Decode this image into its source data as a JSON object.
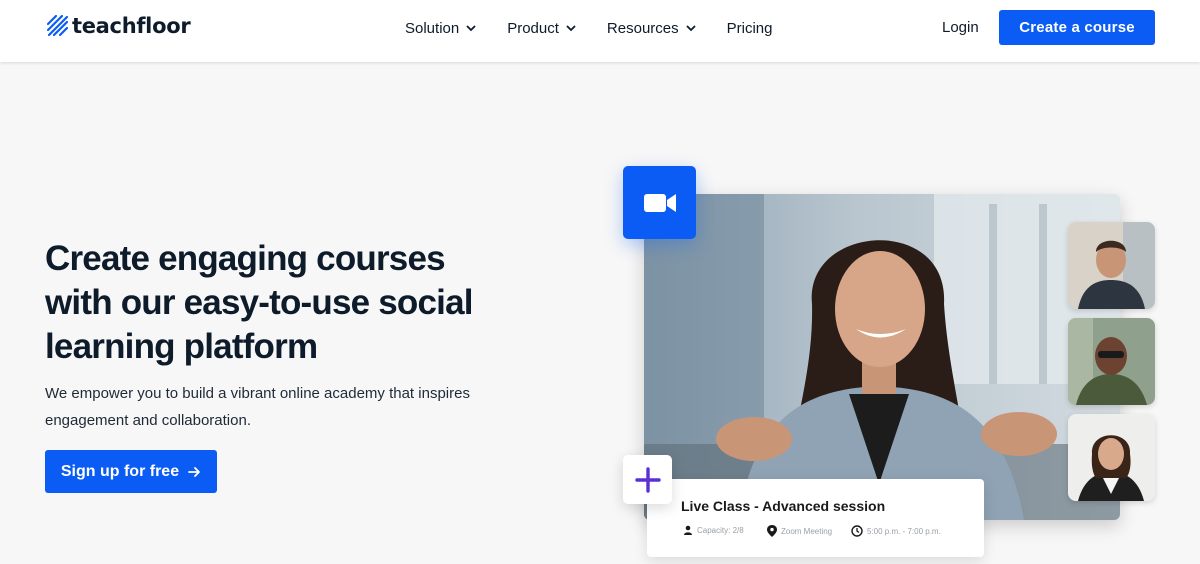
{
  "brand": {
    "name": "teachfloor",
    "accent": "#0a5cf5"
  },
  "nav": {
    "items": [
      {
        "label": "Solution",
        "has_dropdown": true
      },
      {
        "label": "Product",
        "has_dropdown": true
      },
      {
        "label": "Resources",
        "has_dropdown": true
      },
      {
        "label": "Pricing",
        "has_dropdown": false
      }
    ],
    "login": "Login",
    "cta": "Create a course"
  },
  "hero": {
    "title": "Create engaging courses with our easy-to-use social learning platform",
    "subtitle": "We empower you to build a vibrant online academy that inspires engagement and collaboration.",
    "button": "Sign up for free",
    "button_icon": "arrow-right-icon"
  },
  "media": {
    "video_icon": "video-camera-icon",
    "add_icon": "plus-icon",
    "live_class": {
      "title": "Live Class - Advanced session",
      "capacity": "Capacity: 2/8",
      "location": "Zoom Meeting",
      "time": "5:00 p.m. - 7:00 p.m."
    }
  }
}
